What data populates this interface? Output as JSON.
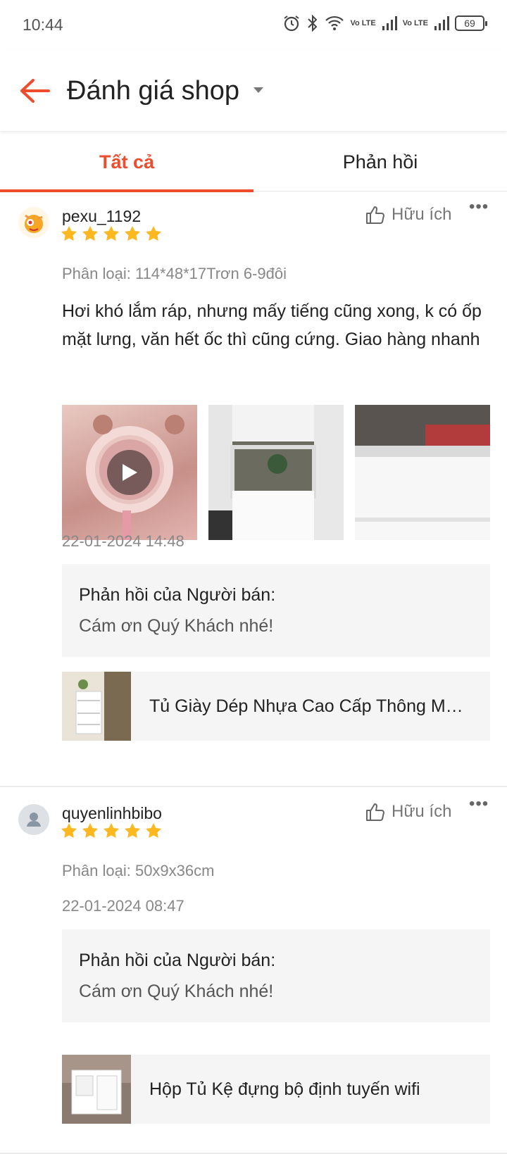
{
  "status_bar": {
    "time": "10:44",
    "battery": "69",
    "lte1": "Vo LTE",
    "lte2": "Vo LTE"
  },
  "header": {
    "title": "Đánh giá shop"
  },
  "tabs": [
    {
      "label": "Tất cả",
      "active": true
    },
    {
      "label": "Phản hồi",
      "active": false
    }
  ],
  "reviews": [
    {
      "username": "pexu_1192",
      "helpful_label": "Hữu ích",
      "rating": 5,
      "variant": "Phân loại: 114*48*17Trơn 6-9đôi",
      "comment": "Hơi khó lắm ráp, nhưng mấy tiếng cũng xong, k có ốp mặt lưng, văn hết ốc thì cũng cứng. Giao hàng nhanh",
      "timestamp": "22-01-2024 14:48",
      "seller_reply_title": "Phản hồi của Người bán:",
      "seller_reply": "Cám ơn Quý Khách nhé!",
      "product_name": "Tủ Giày Dép Nhựa Cao Cấp Thông Minh"
    },
    {
      "username": "quyenlinhbibo",
      "helpful_label": "Hữu ích",
      "rating": 5,
      "variant": "Phân loại: 50x9x36cm",
      "timestamp": "22-01-2024 08:47",
      "seller_reply_title": "Phản hồi của Người bán:",
      "seller_reply": "Cám ơn Quý Khách nhé!",
      "product_name": "Hộp Tủ Kệ đựng bộ định tuyến wifi"
    }
  ],
  "colors": {
    "accent": "#ee4d2d",
    "star": "#fbb820"
  }
}
